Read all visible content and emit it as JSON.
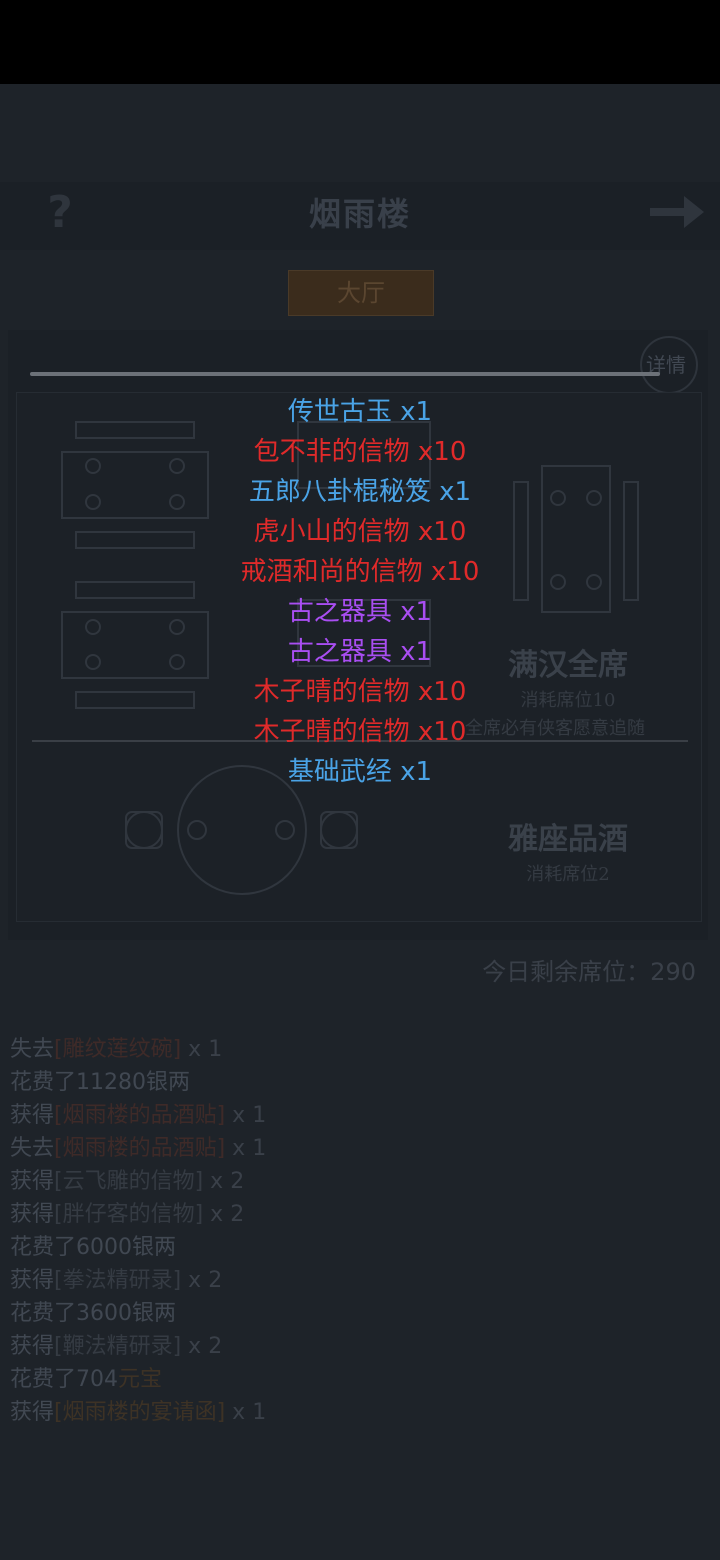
{
  "header": {
    "title": "烟雨楼",
    "help_icon": "question-mark-icon",
    "next_icon": "arrow-right-icon"
  },
  "tabs": {
    "active": "大厅"
  },
  "panel": {
    "detail_label": "详情",
    "feast": {
      "title": "满汉全席",
      "cost": "消耗席位10",
      "desc": "全席必有侠客愿意追随"
    },
    "wine": {
      "title": "雅座品酒",
      "cost": "消耗席位2"
    },
    "seats_label": "今日剩余席位：290"
  },
  "rewards": [
    {
      "name": "传世古玉",
      "qty": " x1",
      "color": "#4aa3e6"
    },
    {
      "name": "包不非的信物",
      "qty": " x10",
      "color": "#e02a2a"
    },
    {
      "name": "五郎八卦棍秘笈",
      "qty": " x1",
      "color": "#4aa3e6"
    },
    {
      "name": "虎小山的信物",
      "qty": " x10",
      "color": "#e02a2a"
    },
    {
      "name": "戒酒和尚的信物",
      "qty": " x10",
      "color": "#e02a2a"
    },
    {
      "name": "古之器具",
      "qty": " x1",
      "color": "#a94ef2"
    },
    {
      "name": "古之器具",
      "qty": " x1",
      "color": "#a94ef2"
    },
    {
      "name": "木子晴的信物",
      "qty": " x10",
      "color": "#e02a2a"
    },
    {
      "name": "木子晴的信物",
      "qty": " x10",
      "color": "#e02a2a"
    },
    {
      "name": "基础武经",
      "qty": " x1",
      "color": "#4aa3e6"
    }
  ],
  "log": [
    {
      "prefix": "失去",
      "item": "[雕纹莲纹碗]",
      "qty": " x 1",
      "tone": "red"
    },
    {
      "prefix": "花费了11280银两",
      "item": "",
      "qty": "",
      "tone": ""
    },
    {
      "prefix": "获得",
      "item": "[烟雨楼的品酒贴]",
      "qty": " x 1",
      "tone": "red"
    },
    {
      "prefix": "失去",
      "item": "[烟雨楼的品酒贴]",
      "qty": " x 1",
      "tone": "red"
    },
    {
      "prefix": "获得",
      "item": "[云飞雕的信物]",
      "qty": " x 2",
      "tone": "gray"
    },
    {
      "prefix": "获得",
      "item": "[胖仔客的信物]",
      "qty": " x 2",
      "tone": "gray"
    },
    {
      "prefix": "花费了6000银两",
      "item": "",
      "qty": "",
      "tone": ""
    },
    {
      "prefix": "获得",
      "item": "[拳法精研录]",
      "qty": " x 2",
      "tone": "gray"
    },
    {
      "prefix": "花费了3600银两",
      "item": "",
      "qty": "",
      "tone": ""
    },
    {
      "prefix": "获得",
      "item": "[鞭法精研录]",
      "qty": " x 2",
      "tone": "gray"
    },
    {
      "prefix": "花费了704",
      "item": "元宝",
      "qty": "",
      "tone": "gold"
    },
    {
      "prefix": "获得",
      "item": "[烟雨楼的宴请函]",
      "qty": " x 1",
      "tone": "gold"
    }
  ]
}
